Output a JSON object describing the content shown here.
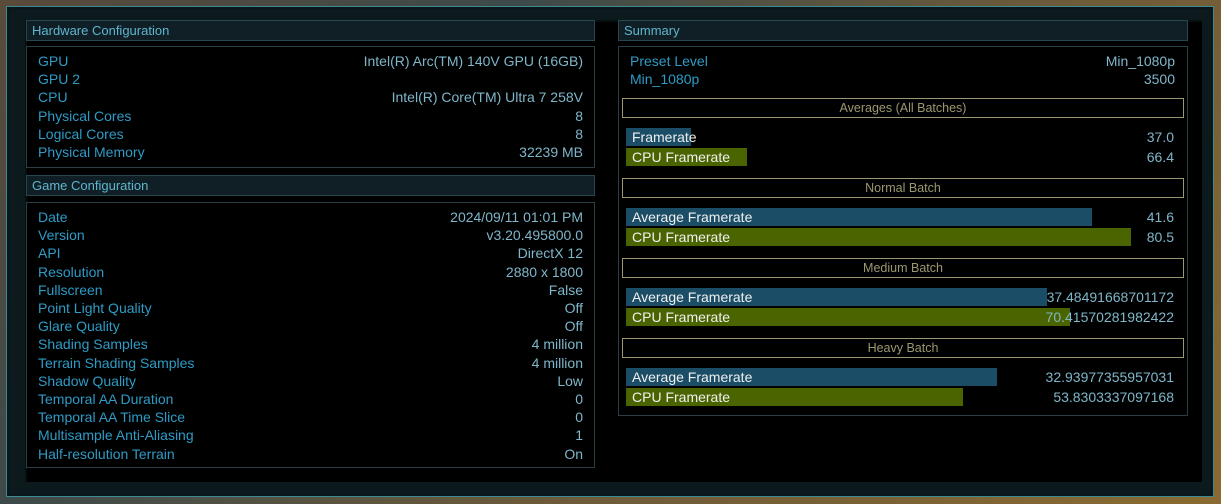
{
  "hardware": {
    "title": "Hardware Configuration",
    "rows": [
      {
        "label": "GPU",
        "value": "Intel(R) Arc(TM) 140V GPU (16GB)"
      },
      {
        "label": "GPU 2",
        "value": ""
      },
      {
        "label": "CPU",
        "value": "Intel(R) Core(TM) Ultra 7 258V"
      },
      {
        "label": "Physical Cores",
        "value": "8"
      },
      {
        "label": "Logical Cores",
        "value": "8"
      },
      {
        "label": "Physical Memory",
        "value": "32239 MB"
      }
    ]
  },
  "game": {
    "title": "Game Configuration",
    "rows": [
      {
        "label": "Date",
        "value": "2024/09/11 01:01 PM"
      },
      {
        "label": "Version",
        "value": "v3.20.495800.0"
      },
      {
        "label": "API",
        "value": "DirectX 12"
      },
      {
        "label": "Resolution",
        "value": "2880 x 1800"
      },
      {
        "label": "Fullscreen",
        "value": "False"
      },
      {
        "label": "Point Light Quality",
        "value": "Off"
      },
      {
        "label": "Glare Quality",
        "value": "Off"
      },
      {
        "label": "Shading Samples",
        "value": "4 million"
      },
      {
        "label": "Terrain Shading Samples",
        "value": "4 million"
      },
      {
        "label": "Shadow Quality",
        "value": "Low"
      },
      {
        "label": "Temporal AA Duration",
        "value": "0"
      },
      {
        "label": "Temporal AA Time Slice",
        "value": "0"
      },
      {
        "label": "Multisample Anti-Aliasing",
        "value": "1"
      },
      {
        "label": "Half-resolution Terrain",
        "value": "On"
      }
    ]
  },
  "summary": {
    "title": "Summary",
    "rows": [
      {
        "label": "Preset Level",
        "value": "Min_1080p"
      },
      {
        "label": "Min_1080p",
        "value": "3500"
      }
    ],
    "batches": [
      {
        "title": "Averages (All Batches)",
        "bars": [
          {
            "label": "Framerate",
            "value": "37.0",
            "kind": "gpu",
            "fill": 0.116
          },
          {
            "label": "CPU Framerate",
            "value": "66.4",
            "kind": "cpu",
            "fill": 0.217
          }
        ]
      },
      {
        "title": "Normal Batch",
        "bars": [
          {
            "label": "Average Framerate",
            "value": "41.6",
            "kind": "gpu",
            "fill": 0.835
          },
          {
            "label": "CPU Framerate",
            "value": "80.5",
            "kind": "cpu",
            "fill": 0.905
          }
        ]
      },
      {
        "title": "Medium Batch",
        "bars": [
          {
            "label": "Average Framerate",
            "value": "37.48491668701172",
            "kind": "gpu",
            "fill": 0.754
          },
          {
            "label": "CPU Framerate",
            "value": "70.41570281982422",
            "kind": "cpu",
            "fill": 0.796
          }
        ]
      },
      {
        "title": "Heavy Batch",
        "bars": [
          {
            "label": "Average Framerate",
            "value": "32.93977355957031",
            "kind": "gpu",
            "fill": 0.665
          },
          {
            "label": "CPU Framerate",
            "value": "53.8303337097168",
            "kind": "cpu",
            "fill": 0.604
          }
        ]
      }
    ]
  },
  "colors": {
    "gpu_bar": "#1b4e66",
    "cpu_bar": "#4a6500",
    "label_blue": "#2e9bc6",
    "value_blue": "#7fb6c9",
    "batch_title": "#9c9770"
  }
}
